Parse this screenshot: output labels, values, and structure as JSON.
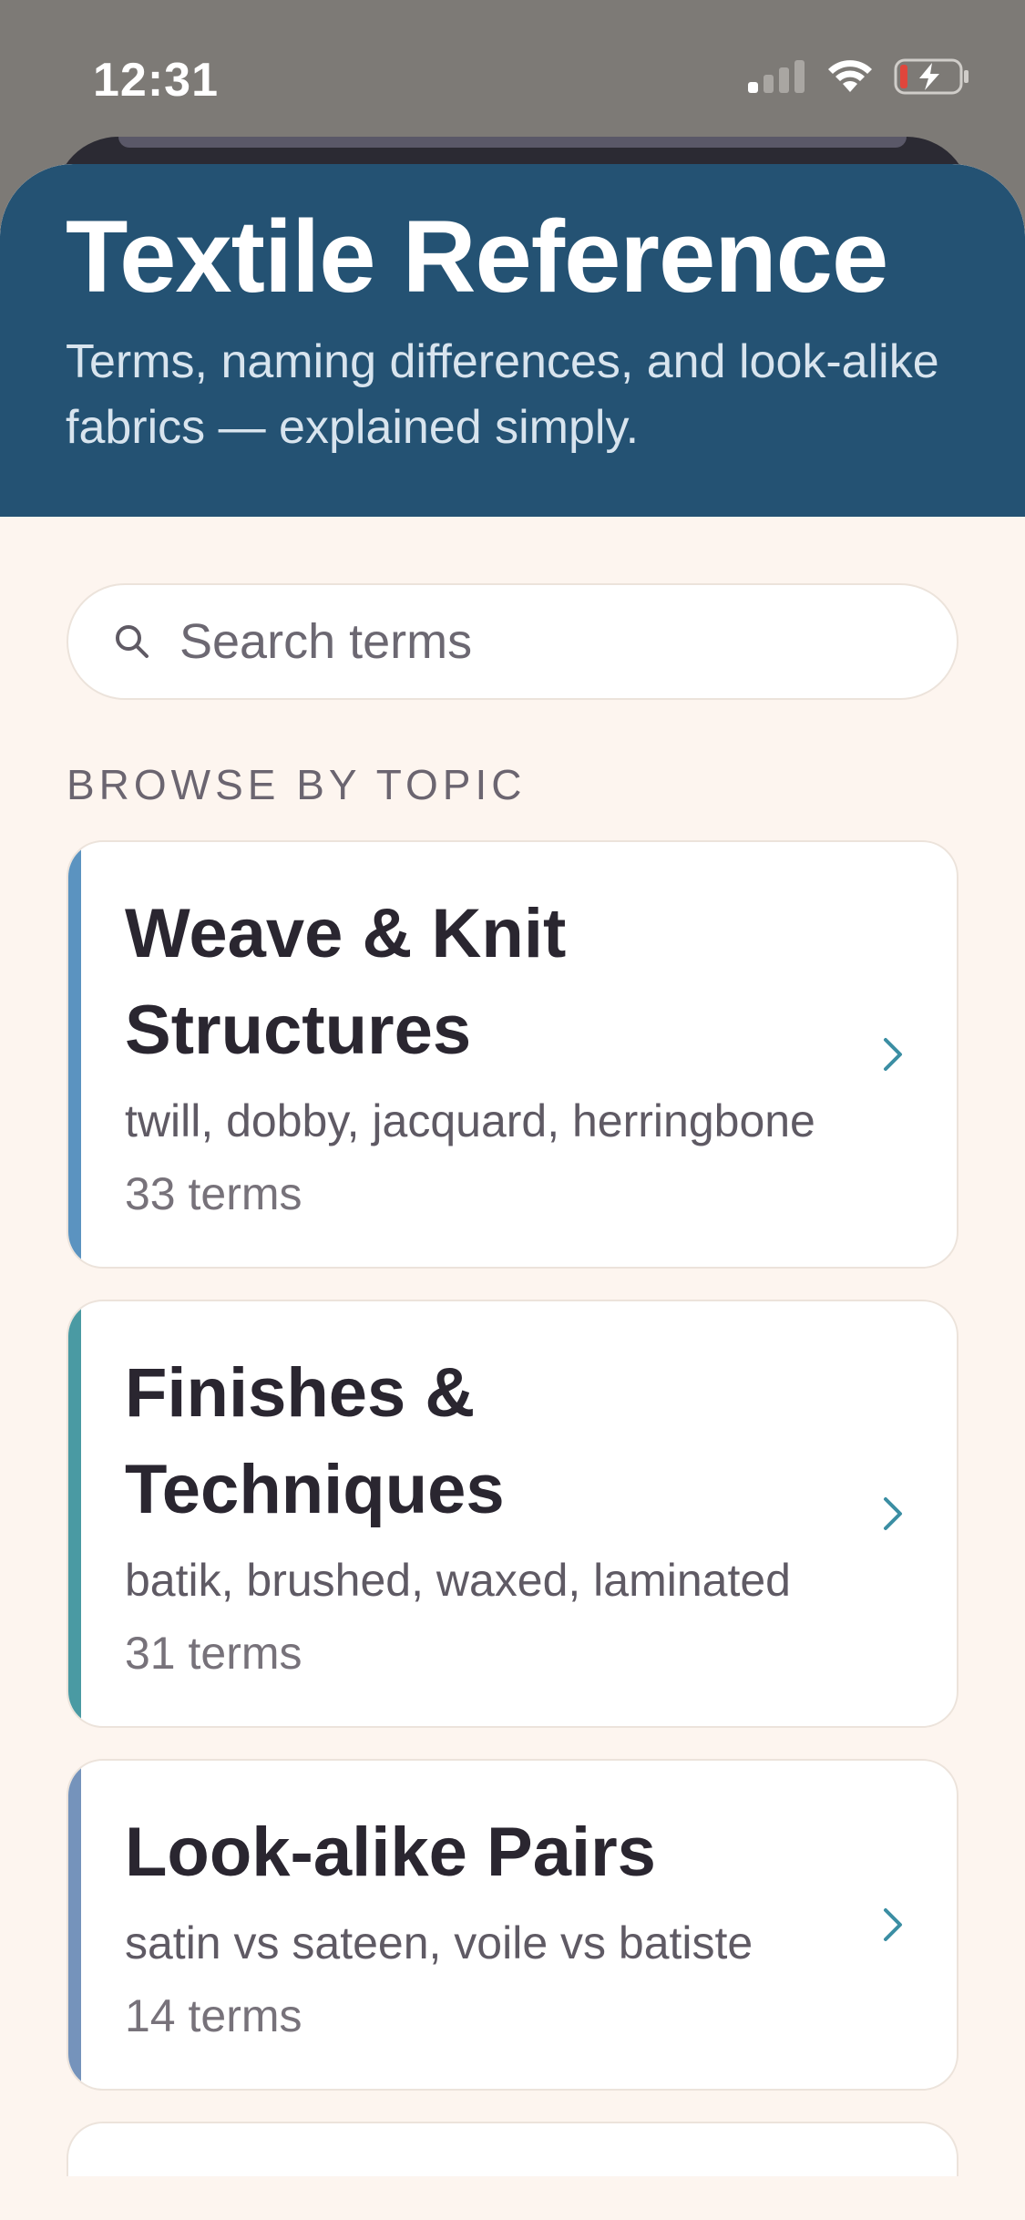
{
  "status_bar": {
    "time": "12:31"
  },
  "header": {
    "title": "Textile Reference",
    "subtitle": "Terms, naming differences, and look-alike fabrics — explained simply."
  },
  "search": {
    "placeholder": "Search terms"
  },
  "browse": {
    "label": "BROWSE BY TOPIC",
    "topics": [
      {
        "title": "Weave & Knit Structures",
        "examples": "twill, dobby, jacquard, herringbone",
        "count": "33 terms",
        "accent": "#5b93c0"
      },
      {
        "title": "Finishes & Techniques",
        "examples": "batik, brushed, waxed, laminated",
        "count": "31 terms",
        "accent": "#4a9aa3"
      },
      {
        "title": "Look-alike Pairs",
        "examples": "satin vs sateen, voile vs batiste",
        "count": "14 terms",
        "accent": "#7593bb"
      }
    ]
  },
  "colors": {
    "header_bg": "#245273",
    "page_bg": "#fdf5ef",
    "chevron": "#3b8ea3"
  }
}
